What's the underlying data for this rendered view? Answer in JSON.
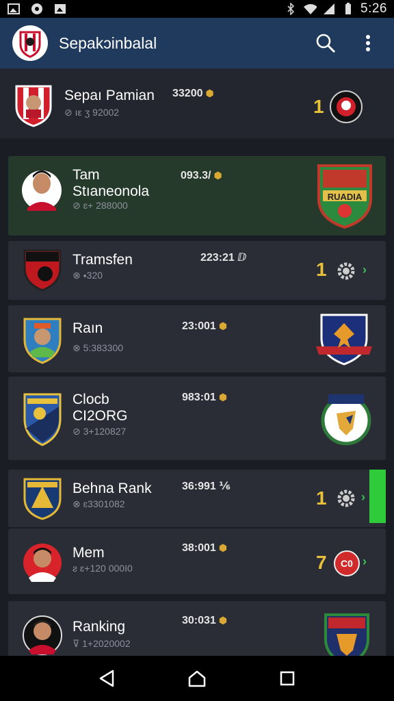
{
  "status_bar": {
    "time": "5:26",
    "left_icons": [
      "image-icon",
      "record-icon",
      "photo-icon"
    ],
    "right_icons": [
      "bluetooth-icon",
      "wifi-icon",
      "signal-icon",
      "battery-icon"
    ]
  },
  "app_bar": {
    "title": "Sepak​ɔinbalal",
    "logo": "club-logo-icon",
    "actions": [
      "search-icon",
      "more-vert-icon"
    ]
  },
  "rows": [
    {
      "name": "Sepaı Pamian",
      "sub": "⊘ ıε ʒ 92002",
      "score": "33200",
      "rank": "1",
      "crest": "ball-crest"
    },
    {
      "name": "Tam\nStıaneonola",
      "sub": "⊘ ɛ+ 288000",
      "score": "093.3/",
      "rank": "",
      "crest": "green-shield-crest",
      "crest_text": "RUADIA"
    },
    {
      "name": "Tramsfen",
      "sub": "⊗ ⬩320",
      "score": "223:21 ⅅ",
      "rank": "1",
      "crest": "gear"
    },
    {
      "name": "Raın",
      "sub": "⊗ 5:383300",
      "score": "23:001",
      "rank": "",
      "crest": "eagle-crest"
    },
    {
      "name": "Clocb\nCI2ORG",
      "sub": "⊘ 3+120827",
      "score": "983:01",
      "rank": "",
      "crest": "wolf-crest"
    },
    {
      "name": "Behna Rank",
      "sub": "⊗ ɛ3301082",
      "score": "36:991 ⅙",
      "rank": "1",
      "crest": "gear"
    },
    {
      "name": "Mem",
      "sub": "ƨ ɛ+120 000I0",
      "score": "38:001",
      "rank": "7",
      "crest": "red-badge",
      "badge_text": "C0"
    },
    {
      "name": "Ranking",
      "sub": "⊽ 1+2020002",
      "score": "30:031",
      "rank": "",
      "crest": "tiger-crest"
    }
  ],
  "nav_bar": {
    "buttons": [
      "back-icon",
      "home-icon",
      "recents-icon"
    ]
  },
  "colors": {
    "app_bar": "#1f3a5c",
    "rank": "#e8c13c",
    "accent_green": "#2ecc3a",
    "card": "#2a2d36"
  }
}
